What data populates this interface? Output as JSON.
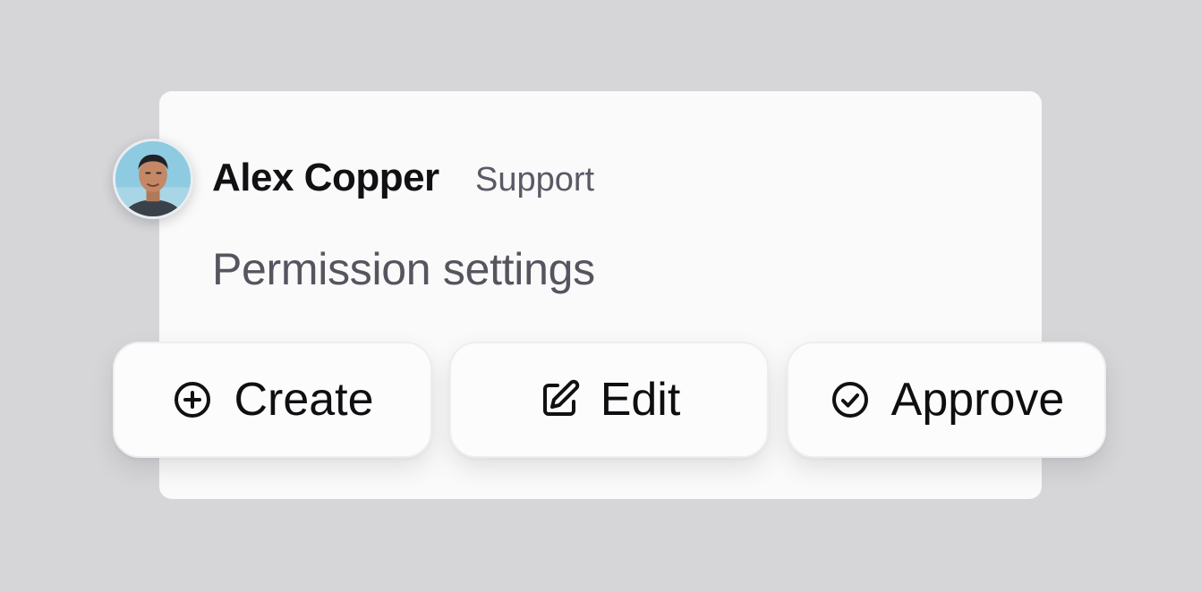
{
  "user": {
    "name": "Alex Copper",
    "role": "Support"
  },
  "subtitle": "Permission settings",
  "actions": [
    {
      "label": "Create",
      "icon": "plus-circle-icon"
    },
    {
      "label": "Edit",
      "icon": "edit-icon"
    },
    {
      "label": "Approve",
      "icon": "check-circle-icon"
    }
  ],
  "colors": {
    "background": "#d6d6d9",
    "card": "#fafafb",
    "text_primary": "#111114",
    "text_secondary": "#55555f"
  }
}
